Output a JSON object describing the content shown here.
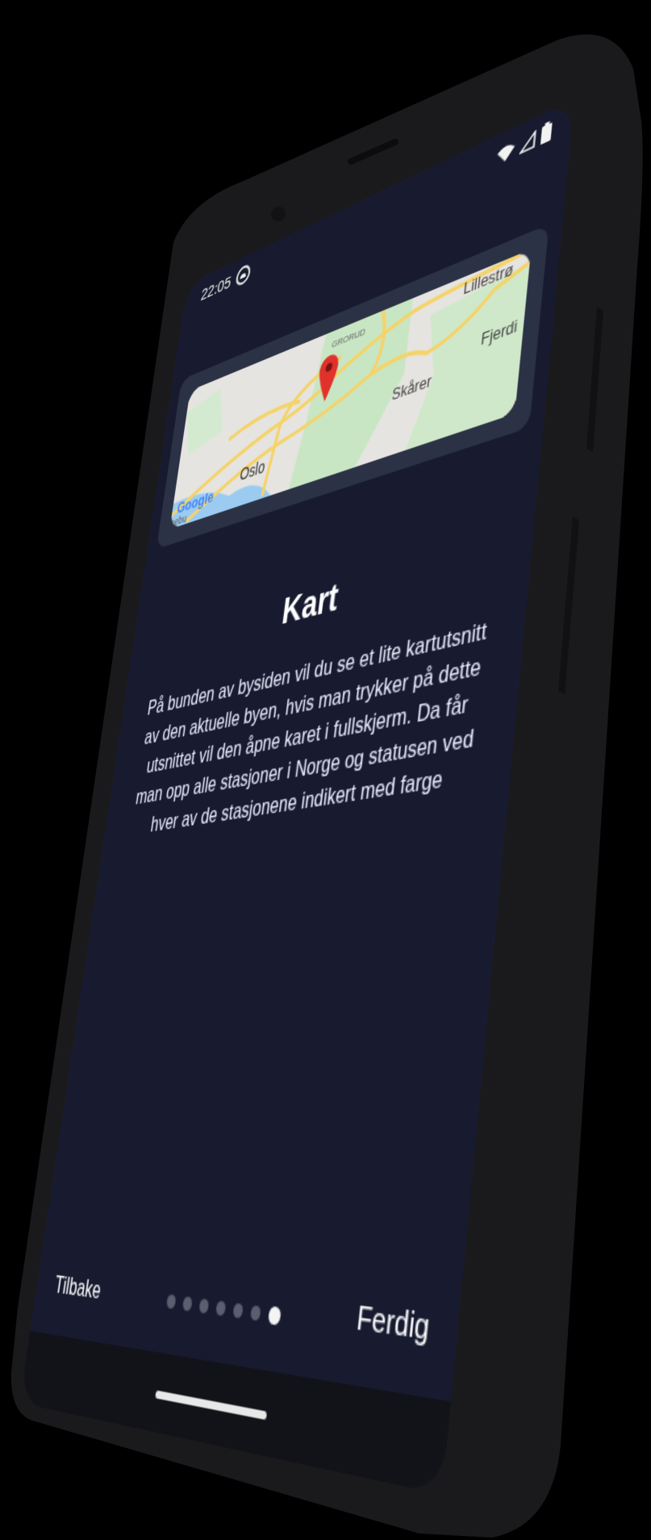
{
  "status_bar": {
    "time": "22:05",
    "icons": [
      "notification-icon",
      "wifi-icon",
      "signal-icon",
      "battery-icon"
    ]
  },
  "map": {
    "labels": {
      "lillestrom": "Lillestrø",
      "grorud": "GRORUD",
      "fjerdingby": "Fjerdi",
      "skarer": "Skårer",
      "oslo": "Oslo",
      "nebu": "nebu"
    },
    "attribution": "Google",
    "colors": {
      "land": "#e6e4e0",
      "park": "#c8e6c4",
      "road": "#f4d36a",
      "water": "#9ccbf2",
      "pin": "#e0322b"
    }
  },
  "page": {
    "title": "Kart",
    "body": "På bunden av bysiden vil du se et lite kartutsnitt av den aktuelle byen, hvis man trykker på dette utsnittet vil den åpne karet i fullskjerm. Da får man opp alle stasjoner i Norge og statusen ved hver av de stasjonene indikert med farge"
  },
  "footer": {
    "back_label": "Tilbake",
    "done_label": "Ferdig",
    "page_count": 7,
    "current_page": 7
  },
  "colors": {
    "screen_bg": "#181b30",
    "card_bg": "#2c3245",
    "phone_body": "#1a1a1c"
  }
}
